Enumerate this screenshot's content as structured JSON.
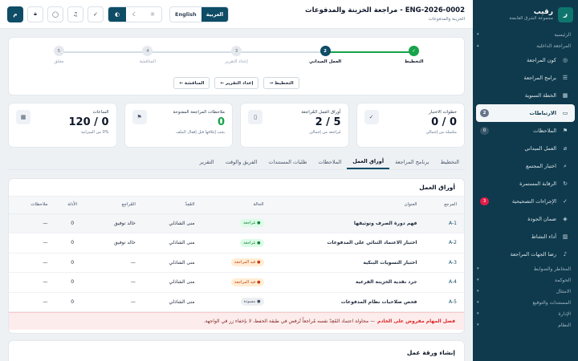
{
  "sidebar": {
    "brand_initial": "ر",
    "brand_name": "رقيب",
    "brand_sub": "مجموعة الشرق القابضة",
    "sections_top": [
      {
        "label": "الرئيسية",
        "chevron": "▾"
      },
      {
        "label": "المراجعة الداخلية",
        "chevron": "▴"
      }
    ],
    "items": [
      {
        "label": "كون المراجعة",
        "icon": "globe-icon",
        "glyph": "◎",
        "badge": ""
      },
      {
        "label": "برامج المراجعة",
        "icon": "list-icon",
        "glyph": "☰",
        "badge": ""
      },
      {
        "label": "الخطة السنوية",
        "icon": "calendar-icon",
        "glyph": "▦",
        "badge": ""
      },
      {
        "label": "الارتباطات",
        "icon": "folder-icon",
        "glyph": "▭",
        "badge": "2",
        "active": true
      },
      {
        "label": "الملاحظات",
        "icon": "flag-icon",
        "glyph": "⚑",
        "badge": "0"
      },
      {
        "label": "العمل الميداني",
        "icon": "clip-icon",
        "glyph": "⌀",
        "badge": ""
      },
      {
        "label": "اختبار المجتمع",
        "icon": "search-icon",
        "glyph": "⌕",
        "badge": ""
      },
      {
        "label": "الرقابة المستمرة",
        "icon": "refresh-icon",
        "glyph": "↻",
        "badge": ""
      },
      {
        "label": "الإجراءات التصحيحية",
        "icon": "check-circle-icon",
        "glyph": "✓",
        "badge": "3",
        "badge_red": true
      },
      {
        "label": "ضمان الجودة",
        "icon": "shield-check-icon",
        "glyph": "◈",
        "badge": ""
      },
      {
        "label": "أداء النشاط",
        "icon": "bar-chart-icon",
        "glyph": "▥",
        "badge": ""
      },
      {
        "label": "رضا الجهات المراجعة",
        "icon": "bell-icon",
        "glyph": "♪",
        "badge": ""
      }
    ],
    "sections_bottom": [
      {
        "label": "المخاطر والضوابط",
        "chevron": "▾"
      },
      {
        "label": "الحوكمة",
        "chevron": "▾"
      },
      {
        "label": "الامتثال",
        "chevron": "▾"
      },
      {
        "label": "المستندات والتوقيع",
        "chevron": "▾"
      },
      {
        "label": "الإدارة",
        "chevron": "▾"
      },
      {
        "label": "النظام",
        "chevron": "▾"
      }
    ]
  },
  "header": {
    "title": "ENG-2026-0002 - مراجعة الخزينة والمدفوعات",
    "breadcrumb": "الخزينة والمدفوعات",
    "lang_ar": "العربية",
    "lang_en": "English",
    "avatar_initial": "م"
  },
  "stepper": {
    "steps": [
      {
        "label": "التخطيط",
        "marker": "✓",
        "state": "done"
      },
      {
        "label": "العمل الميداني",
        "marker": "2",
        "state": "current"
      },
      {
        "label": "إعداد التقرير",
        "marker": "3",
        "state": "todo"
      },
      {
        "label": "المناقشة",
        "marker": "4",
        "state": "todo"
      },
      {
        "label": "مغلق",
        "marker": "5",
        "state": "todo"
      }
    ],
    "buttons": [
      "التخطيط →",
      "إعداد التقرير ←",
      "المناقشة ←"
    ]
  },
  "stats": [
    {
      "label": "خطوات الاختبار",
      "value": "0 / 0",
      "hint": "مكتملة من إجمالي",
      "icon": "check-icon",
      "glyph": "✓"
    },
    {
      "label": "أوراق العمل المُراجعة",
      "value": "2 / 5",
      "hint": "مُراجعة من إجمالي",
      "icon": "document-icon",
      "glyph": "▯"
    },
    {
      "label": "ملاحظات المراجعة المفتوحة",
      "value": "0",
      "hint": "يجب إغلاقها قبل إقفال الملف",
      "icon": "flag-icon",
      "glyph": "⚑",
      "green": true
    },
    {
      "label": "الساعات",
      "value": "120 / 0",
      "hint": "0% من الميزانية",
      "icon": "calendar-icon",
      "glyph": "▦"
    }
  ],
  "tabs": [
    "التخطيط",
    "برنامج المراجعة",
    "أوراق العمل",
    "الملاحظات",
    "طلبات المستندات",
    "الفريق والوقت",
    "التقرير"
  ],
  "active_tab": 2,
  "workpapers": {
    "title": "أوراق العمل",
    "columns": [
      "المرجع",
      "العنوان",
      "الحالة",
      "المُعِدّ",
      "المُراجِع",
      "الأدلة",
      "ملاحظات"
    ],
    "rows": [
      {
        "ref": "A-1",
        "title": "فهم دورة الصرف وتوثيقها",
        "status": "مُراجعة",
        "status_type": "green",
        "preparer": "منى الشاذلي",
        "reviewer": "خالد توفيق",
        "evidence": "0",
        "notes": "—",
        "highlight": true
      },
      {
        "ref": "A-2",
        "title": "اختبار الاعتماد الثنائي على المدفوعات",
        "status": "مُراجعة",
        "status_type": "green",
        "preparer": "منى الشاذلي",
        "reviewer": "خالد توفيق",
        "evidence": "0",
        "notes": "—"
      },
      {
        "ref": "A-3",
        "title": "اختبار التسويات البنكية",
        "status": "قيد المراجعة",
        "status_type": "amber",
        "preparer": "منى الشاذلي",
        "reviewer": "—",
        "evidence": "0",
        "notes": "—"
      },
      {
        "ref": "A-4",
        "title": "جرد نقدية الخزينة الفرعية",
        "status": "قيد المراجعة",
        "status_type": "amber",
        "preparer": "منى الشاذلي",
        "reviewer": "—",
        "evidence": "0",
        "notes": "—"
      },
      {
        "ref": "A-5",
        "title": "فحص صلاحيات نظام المدفوعات",
        "status": "مسودة",
        "status_type": "gray",
        "preparer": "منى الشاذلي",
        "reviewer": "—",
        "evidence": "0",
        "notes": "—"
      }
    ]
  },
  "warning": {
    "title": "فصل المهام مفروض على الخادم",
    "text": " — محاولة اعتماد المُعِدّ نفسه مُراجعاً تُرفض في طبقة الحفظ، لا بإخفاء زر في الواجهة."
  },
  "create": {
    "title": "إنشاء ورقة عمل"
  },
  "colors": {
    "sidebar": "#0f3a4d",
    "primary": "#0f4c66",
    "success": "#16a34a",
    "danger": "#dc2626"
  }
}
